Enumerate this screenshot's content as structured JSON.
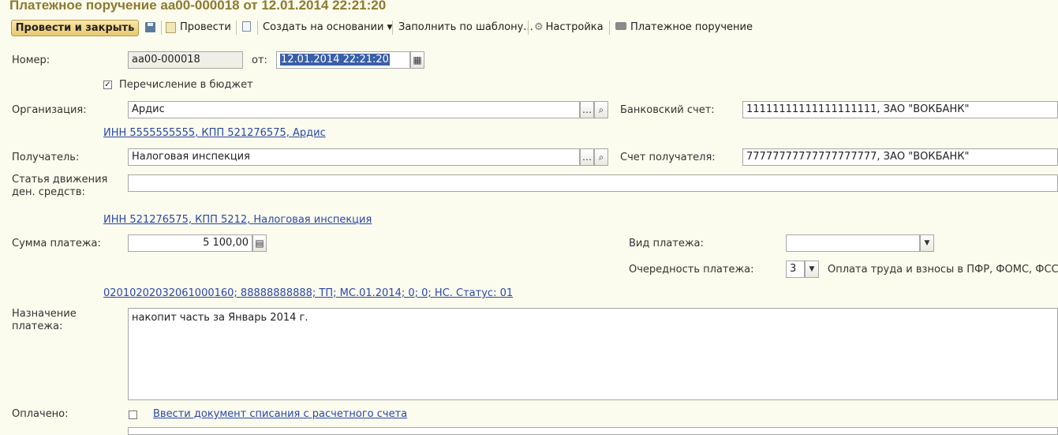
{
  "window": {
    "title": "Платежное поручение аа00-000018 от 12.01.2014 22:21:20"
  },
  "toolbar": {
    "post_close": "Провести и закрыть",
    "post": "Провести",
    "create_based": "Создать на основании",
    "fill_template": "Заполнить по шаблону...",
    "settings": "Настройка",
    "print_payment": "Платежное поручение"
  },
  "form": {
    "number_label": "Номер:",
    "number_value": "аа00-000018",
    "from_label": "от:",
    "date_value": "12.01.2014 22:21:20",
    "budget_transfer": {
      "label": "Перечисление в бюджет",
      "checked": true
    },
    "organization_label": "Организация:",
    "organization_value": "Ардис",
    "organization_info": "ИНН 5555555555, КПП 521276575, Ардис",
    "bank_account_label": "Банковский счет:",
    "bank_account_value": "11111111111111111111, ЗАО \"ВОКБАНК\"",
    "recipient_label": "Получатель:",
    "recipient_value": "Налоговая инспекция",
    "recipient_account_label": "Счет получателя:",
    "recipient_account_value": "77777777777777777777, ЗАО \"ВОКБАНК\"",
    "cashflow_label_1": "Статья движения",
    "cashflow_label_2": "ден. средств:",
    "cashflow_value": "",
    "recipient_info": "ИНН 521276575, КПП 5212, Налоговая инспекция",
    "amount_label": "Сумма платежа:",
    "amount_value": "5 100,00",
    "payment_type_label": "Вид платежа:",
    "payment_type_value": "",
    "priority_label": "Очередность платежа:",
    "priority_value": "3",
    "priority_desc": "Оплата труда и взносы в ПФР, ФОМС, ФСС",
    "tax_details_link": "02010202032061000160; 88888888888; ТП; МС.01.2014; 0; 0; НС. Статус: 01",
    "purpose_label_1": "Назначение",
    "purpose_label_2": "платежа:",
    "purpose_value": "накопит часть за Январь 2014 г.",
    "paid_label": "Оплачено:",
    "paid_checked": false,
    "paid_link": "Ввести документ списания с расчетного счета"
  }
}
